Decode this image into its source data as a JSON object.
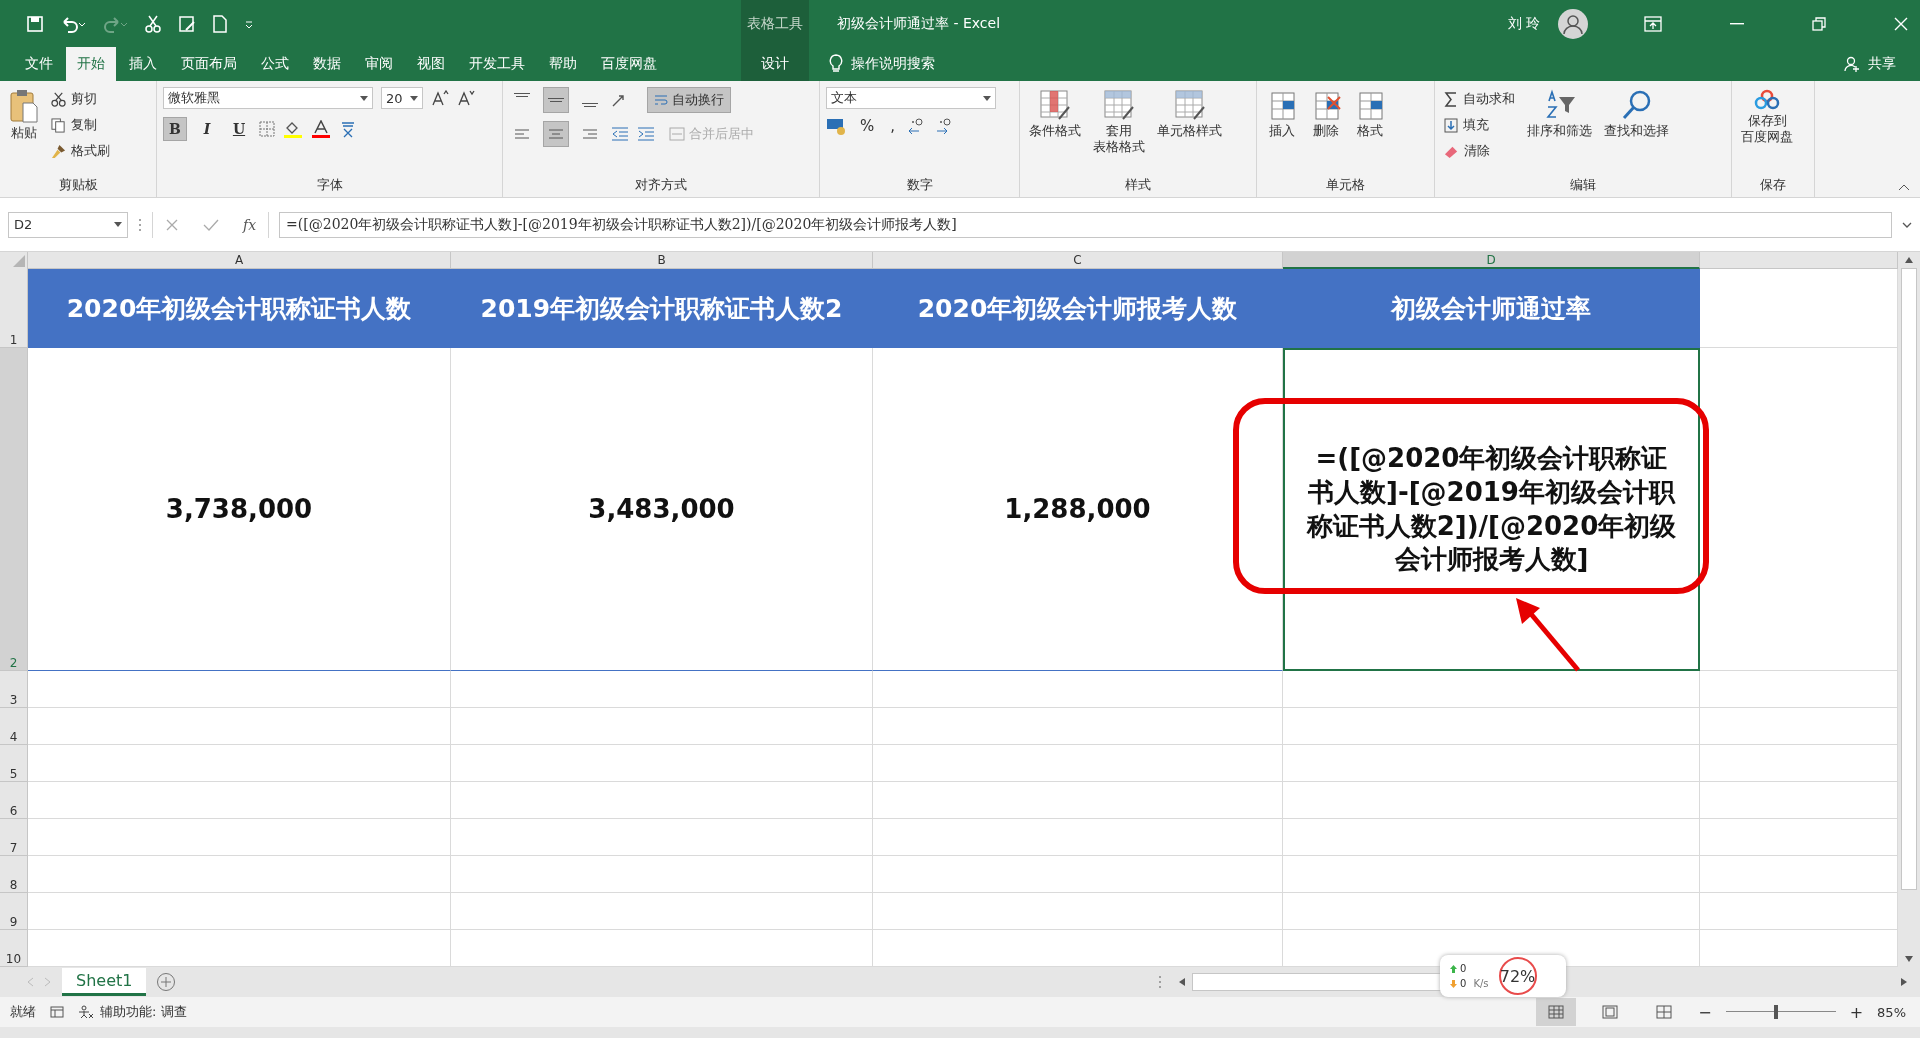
{
  "title_bar": {
    "contextual_label": "表格工具",
    "title": "初级会计师通过率  -  Excel",
    "user": "刘 玲"
  },
  "menu_tabs": [
    {
      "label": "文件",
      "selected": false
    },
    {
      "label": "开始",
      "selected": true
    },
    {
      "label": "插入",
      "selected": false
    },
    {
      "label": "页面布局",
      "selected": false
    },
    {
      "label": "公式",
      "selected": false
    },
    {
      "label": "数据",
      "selected": false
    },
    {
      "label": "审阅",
      "selected": false
    },
    {
      "label": "视图",
      "selected": false
    },
    {
      "label": "开发工具",
      "selected": false
    },
    {
      "label": "帮助",
      "selected": false
    },
    {
      "label": "百度网盘",
      "selected": false
    }
  ],
  "contextual_tab": {
    "label": "设计",
    "selected": false
  },
  "tell_me": "操作说明搜索",
  "share": "共享",
  "ribbon": {
    "clipboard": {
      "paste": "粘贴",
      "items": [
        "剪切",
        "复制",
        "格式刷"
      ],
      "label": "剪贴板"
    },
    "font": {
      "name": "微软雅黑",
      "size": "20",
      "styles": [
        {
          "label": "B",
          "on": true
        },
        {
          "label": "I",
          "on": false
        },
        {
          "label": "U",
          "on": false
        }
      ],
      "label": "字体"
    },
    "alignment": {
      "vertical": [
        {
          "selected": false
        },
        {
          "selected": true
        },
        {
          "selected": false
        }
      ],
      "horizontal": [
        {
          "selected": false
        },
        {
          "selected": true
        },
        {
          "selected": false
        }
      ],
      "wrap": {
        "label": "自动换行",
        "on": true
      },
      "merge": {
        "label": "合并后居中",
        "disabled": true
      },
      "label": "对齐方式"
    },
    "number": {
      "format": "文本",
      "percent": "%",
      "comma": ",",
      "label": "数字"
    },
    "styles": {
      "items": [
        [
          "条件格式"
        ],
        [
          "套用",
          "表格格式"
        ],
        [
          "单元格样式"
        ]
      ],
      "label": "样式"
    },
    "cells": {
      "items": [
        "插入",
        "删除",
        "格式"
      ],
      "label": "单元格"
    },
    "editing": {
      "small": [
        "自动求和",
        "填充",
        "清除"
      ],
      "large": [
        "排序和筛选",
        "查找和选择"
      ],
      "label": "编辑"
    },
    "save": {
      "item": [
        "保存到",
        "百度网盘"
      ],
      "label": "保存"
    }
  },
  "formula_bar": {
    "name_box": "D2",
    "fx": "fx",
    "formula": "=([@2020年初级会计职称证书人数]-[@2019年初级会计职称证书人数2])/[@2020年初级会计师报考人数]"
  },
  "sheet": {
    "columns": [
      {
        "label": "A",
        "selected": false
      },
      {
        "label": "B",
        "selected": false
      },
      {
        "label": "C",
        "selected": false
      },
      {
        "label": "D",
        "selected": true
      }
    ],
    "rows": [
      {
        "label": "1",
        "selected": false
      },
      {
        "label": "2",
        "selected": true
      },
      {
        "label": "3",
        "selected": false
      },
      {
        "label": "4",
        "selected": false
      },
      {
        "label": "5",
        "selected": false
      },
      {
        "label": "6",
        "selected": false
      },
      {
        "label": "7",
        "selected": false
      },
      {
        "label": "8",
        "selected": false
      },
      {
        "label": "9",
        "selected": false
      },
      {
        "label": "10",
        "selected": false
      }
    ],
    "header_cells": [
      "2020年初级会计职称证书人数",
      "2019年初级会计职称证书人数2",
      "2020年初级会计师报考人数",
      "初级会计师通过率"
    ],
    "value_cells": [
      "3,738,000",
      "3,483,000",
      "1,288,000",
      "=([@2020年初级会计职称证书人数]-[@2019年初级会计职称证书人数2])/[@2020年初级会计师报考人数]"
    ]
  },
  "sheet_tabs": [
    {
      "label": "Sheet1",
      "selected": true
    }
  ],
  "status_bar": {
    "ready": "就绪",
    "accessibility": "辅助功能: 调查",
    "view": [
      {
        "selected": true
      },
      {
        "selected": false
      },
      {
        "selected": false
      }
    ],
    "zoom_out": "−",
    "zoom_in": "+",
    "zoom": {
      "level": 0.46
    },
    "zoom_label": "85%"
  },
  "speed_widget": {
    "up": "0",
    "down": "0",
    "unit": "K/s",
    "percent": "72%"
  }
}
